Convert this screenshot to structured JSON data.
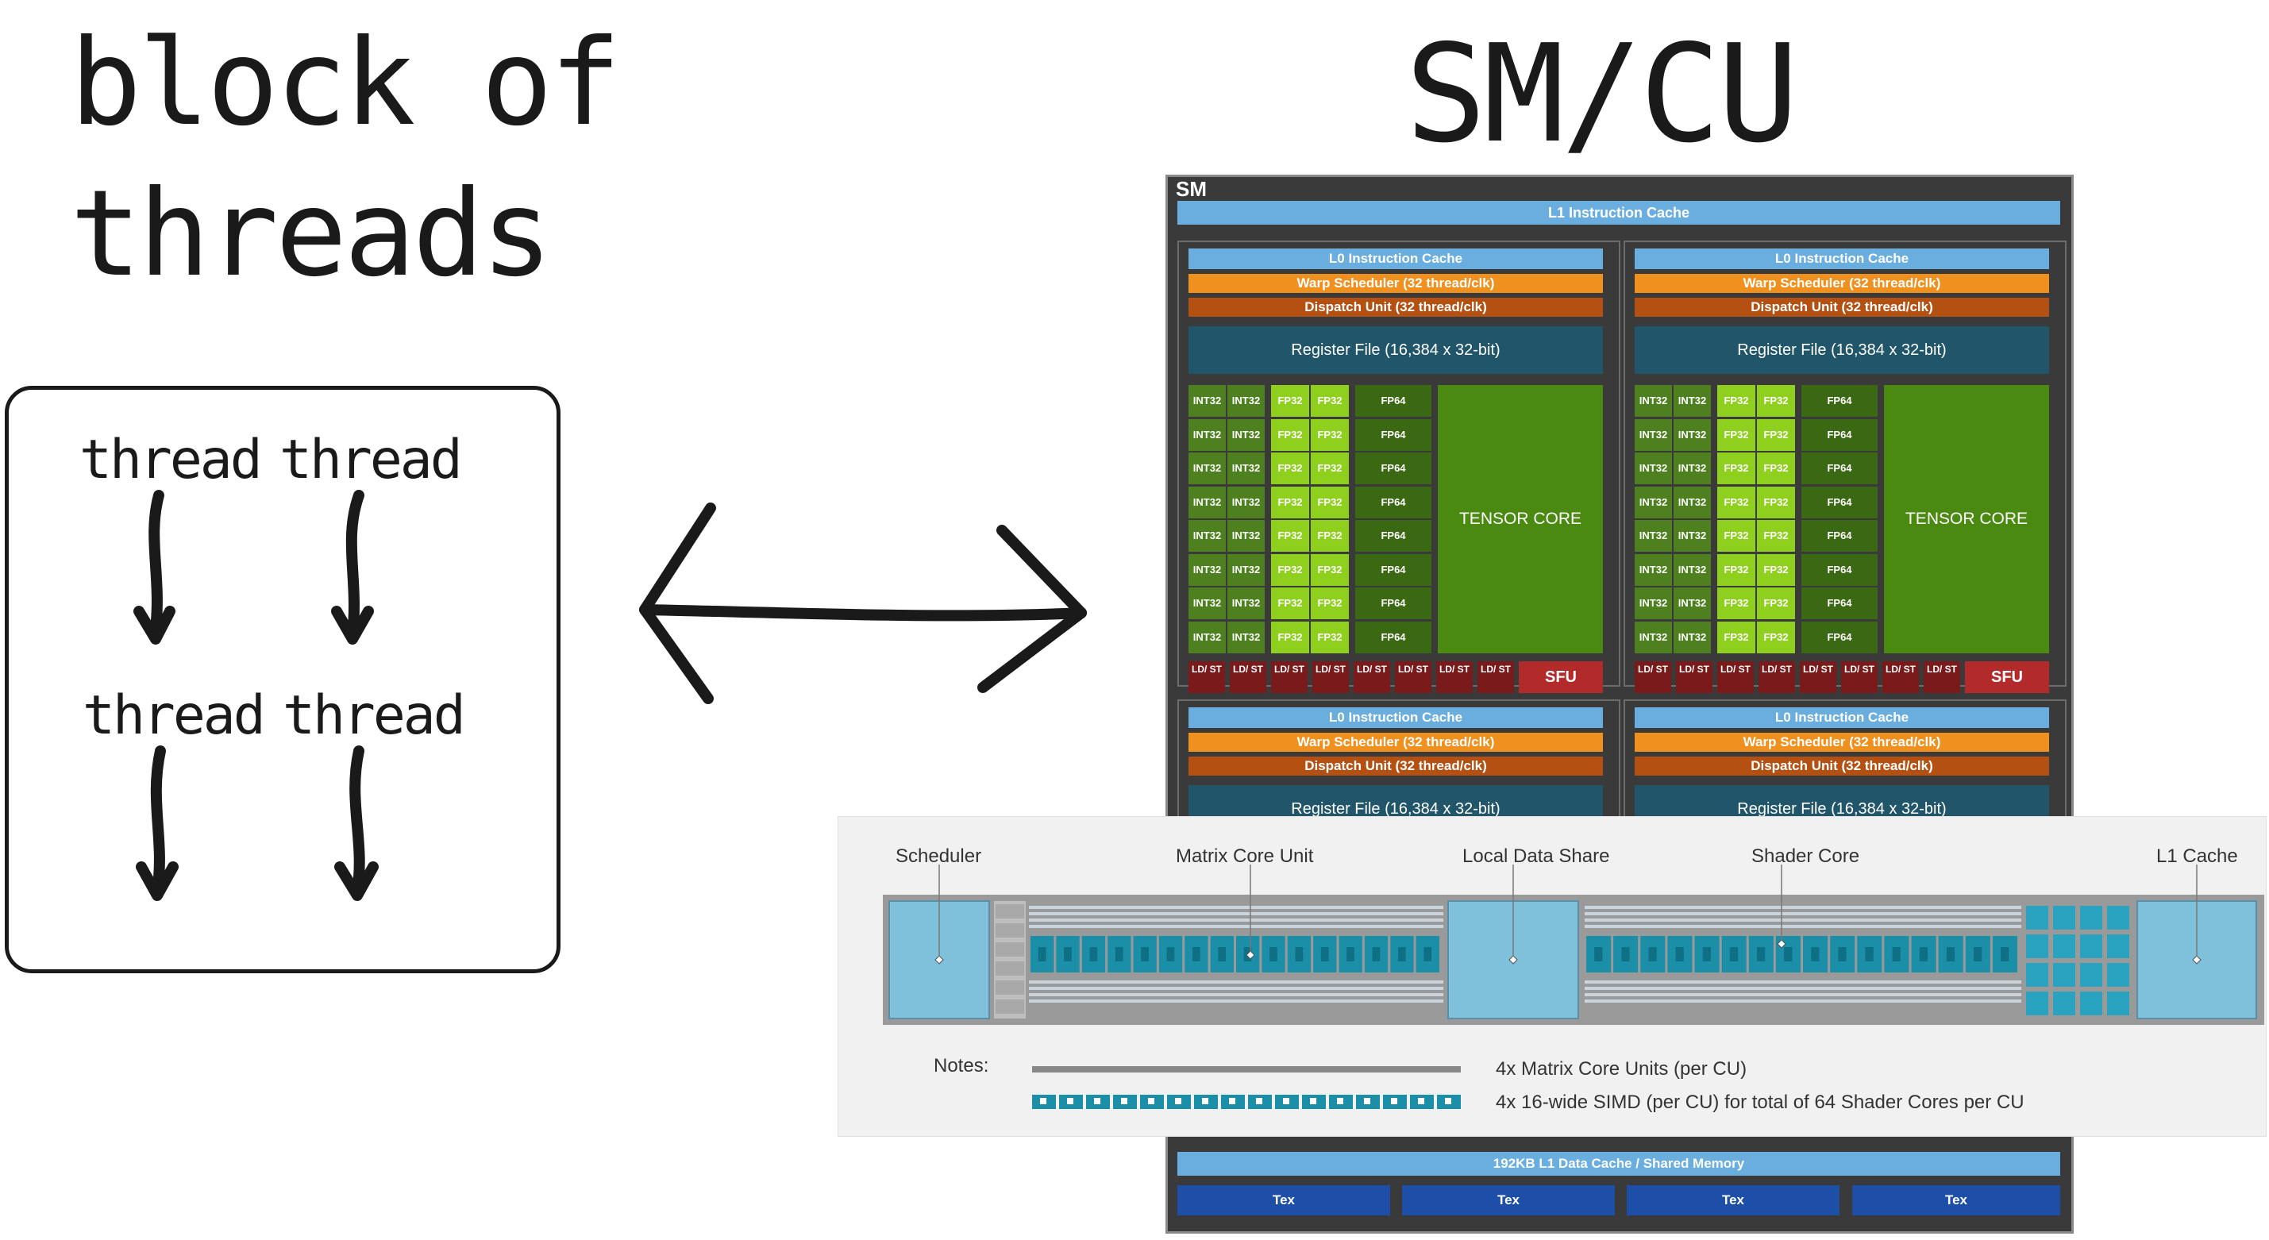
{
  "left": {
    "title_line1": "block of",
    "title_line2": "threads",
    "threads": [
      "thread",
      "thread",
      "thread",
      "thread"
    ]
  },
  "right": {
    "title": "SM/CU"
  },
  "sm": {
    "label": "SM",
    "l1_instruction_cache": "L1 Instruction Cache",
    "l0_instruction_cache": "L0 Instruction Cache",
    "warp_scheduler": "Warp Scheduler (32 thread/clk)",
    "dispatch_unit": "Dispatch Unit (32 thread/clk)",
    "register_file": "Register File (16,384 x 32-bit)",
    "int32": "INT32",
    "fp32": "FP32",
    "fp64": "FP64",
    "tensor_core": "TENSOR CORE",
    "ldst": "LD/ ST",
    "sfu": "SFU",
    "l1_data_cache": "192KB L1 Data Cache / Shared Memory",
    "tex": [
      "Tex",
      "Tex",
      "Tex",
      "Tex"
    ]
  },
  "cu": {
    "labels": {
      "scheduler": "Scheduler",
      "matrix_core_unit": "Matrix Core Unit",
      "local_data_share": "Local Data Share",
      "shader_core": "Shader Core",
      "l1_cache": "L1 Cache"
    },
    "notes_label": "Notes:",
    "notes": [
      "4x  Matrix Core Units (per CU)",
      "4x  16-wide SIMD (per CU) for total of 64 Shader Cores per CU"
    ]
  },
  "colors": {
    "sm_bg": "#3a3a3a",
    "l1_blue": "#6aaee0",
    "warp_orange": "#f0901e",
    "dispatch_brown": "#b35012",
    "register_teal": "#215569",
    "fp32_green": "#8fcf1e",
    "int_green": "#4e8020",
    "tensor_green": "#4a8a10",
    "ldst_red": "#7a1a1a",
    "tex_blue": "#1d4fa8",
    "cu_teal": "#1b8fa8",
    "cu_lightblue": "#7fc0da"
  }
}
